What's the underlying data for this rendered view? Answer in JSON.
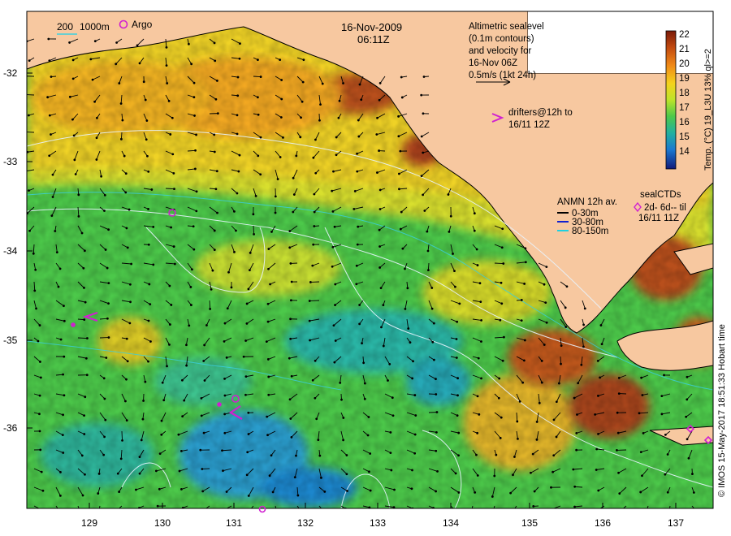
{
  "map": {
    "date": "16-Nov-2009",
    "time": "06:11Z",
    "bathy_legend": {
      "depth1": "200",
      "depth2": "1000m"
    },
    "argo_label": "Argo",
    "altimetry_note": [
      "Altimetric sealevel",
      "(0.1m contours)",
      "and velocity for",
      "16-Nov 06Z",
      "0.5m/s (1kt 24h)"
    ],
    "drifters_note": [
      "drifters@12h to",
      "16/11 12Z"
    ],
    "anmn_legend": {
      "title": "ANMN 12h av.",
      "items": [
        "0-30m",
        "30-80m",
        "80-150m"
      ]
    },
    "seal_legend": {
      "title": "sealCTDs",
      "line1": "2d- 6d-- til",
      "line2": "16/11 11Z"
    },
    "colorbar": {
      "label": "Temp. (°C) 19_L3U 13% ql>=2",
      "ticks": [
        "22",
        "21",
        "20",
        "19",
        "18",
        "17",
        "16",
        "15",
        "14"
      ]
    },
    "x_axis_labels": [
      "129",
      "130",
      "131",
      "132",
      "133",
      "134",
      "135",
      "136",
      "137"
    ],
    "y_axis_labels": [
      "-32",
      "-33",
      "-34",
      "-35",
      "-36"
    ],
    "credit": "© IMOS 15-May-2017 18:51:33 Hobart time",
    "colors": {
      "land": "#f7c8a0",
      "warm": "#9a3a12",
      "mid": "#e3d12e",
      "cool": "#3bbb52",
      "cold": "#1a8cd0"
    }
  }
}
